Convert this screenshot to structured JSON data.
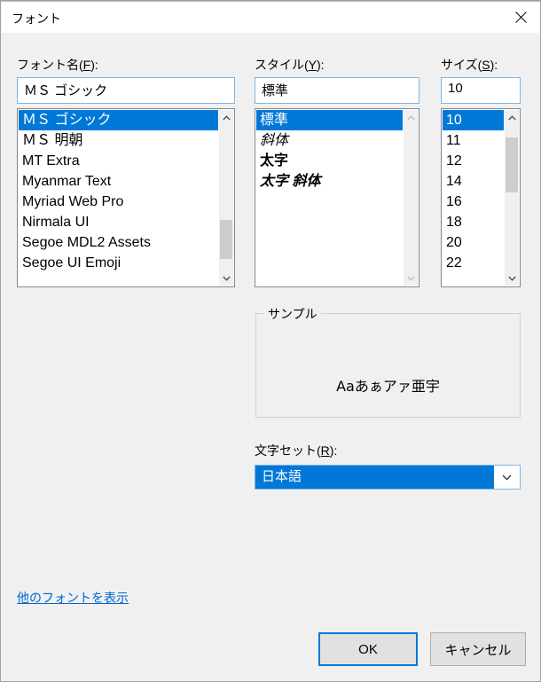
{
  "window": {
    "title": "フォント",
    "close_icon": "close-icon"
  },
  "font_name": {
    "label_prefix": "フォント名(",
    "label_accel": "F",
    "label_suffix": "):",
    "value": "ＭＳ ゴシック",
    "items": [
      "ＭＳ ゴシック",
      "ＭＳ 明朝",
      "MT Extra",
      "Myanmar Text",
      "Myriad Web Pro",
      "Nirmala UI",
      "Segoe MDL2 Assets",
      "Segoe UI Emoji"
    ],
    "selected_index": 0
  },
  "style": {
    "label_prefix": "スタイル(",
    "label_accel": "Y",
    "label_suffix": "):",
    "value": "標準",
    "items": [
      "標準",
      "斜体",
      "太字",
      "太字 斜体"
    ],
    "selected_index": 0
  },
  "size": {
    "label_prefix": "サイズ(",
    "label_accel": "S",
    "label_suffix": "):",
    "value": "10",
    "items": [
      "10",
      "11",
      "12",
      "14",
      "16",
      "18",
      "20",
      "22"
    ],
    "selected_index": 0
  },
  "sample": {
    "group_label": "サンプル",
    "text": "Aaあぁアァ亜宇"
  },
  "charset": {
    "label_prefix": "文字セット(",
    "label_accel": "R",
    "label_suffix": "):",
    "value": "日本語"
  },
  "links": {
    "show_more_fonts": "他のフォントを表示"
  },
  "buttons": {
    "ok": "OK",
    "cancel": "キャンセル"
  },
  "colors": {
    "accent": "#0078d7",
    "dialog_bg": "#f0f0f0",
    "link": "#0066cc",
    "button_face": "#e1e1e1",
    "scroll_thumb": "#cdcdcd"
  }
}
